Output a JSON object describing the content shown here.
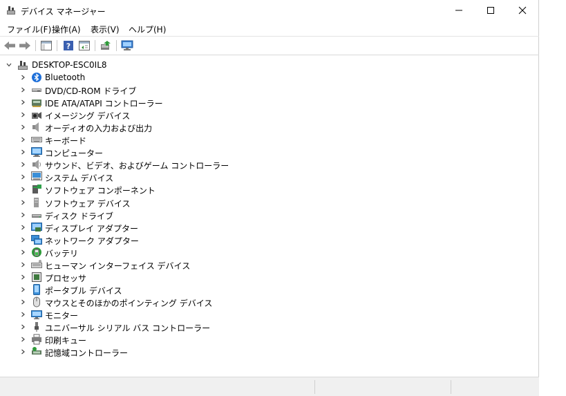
{
  "window": {
    "title": "デバイス マネージャー"
  },
  "menu": [
    {
      "label": "ファイル(F)"
    },
    {
      "label": "操作(A)"
    },
    {
      "label": "表示(V)"
    },
    {
      "label": "ヘルプ(H)"
    }
  ],
  "tree": {
    "root": {
      "label": "DESKTOP-ESC0IL8"
    },
    "items": [
      {
        "label": "Bluetooth",
        "icon": "bluetooth-icon"
      },
      {
        "label": "DVD/CD-ROM ドライブ",
        "icon": "dvd-drive-icon"
      },
      {
        "label": "IDE ATA/ATAPI コントローラー",
        "icon": "ide-controller-icon"
      },
      {
        "label": "イメージング デバイス",
        "icon": "imaging-device-icon"
      },
      {
        "label": "オーディオの入力および出力",
        "icon": "speaker-icon"
      },
      {
        "label": "キーボード",
        "icon": "keyboard-icon"
      },
      {
        "label": "コンピューター",
        "icon": "computer-icon"
      },
      {
        "label": "サウンド、ビデオ、およびゲーム コントローラー",
        "icon": "sound-icon"
      },
      {
        "label": "システム デバイス",
        "icon": "system-device-icon"
      },
      {
        "label": "ソフトウェア コンポーネント",
        "icon": "software-component-icon"
      },
      {
        "label": "ソフトウェア デバイス",
        "icon": "software-device-icon"
      },
      {
        "label": "ディスク ドライブ",
        "icon": "disk-drive-icon"
      },
      {
        "label": "ディスプレイ アダプター",
        "icon": "display-adapter-icon"
      },
      {
        "label": "ネットワーク アダプター",
        "icon": "network-adapter-icon"
      },
      {
        "label": "バッテリ",
        "icon": "battery-icon"
      },
      {
        "label": "ヒューマン インターフェイス デバイス",
        "icon": "hid-icon"
      },
      {
        "label": "プロセッサ",
        "icon": "processor-icon"
      },
      {
        "label": "ポータブル デバイス",
        "icon": "portable-device-icon"
      },
      {
        "label": "マウスとそのほかのポインティング デバイス",
        "icon": "mouse-icon"
      },
      {
        "label": "モニター",
        "icon": "monitor-icon"
      },
      {
        "label": "ユニバーサル シリアル バス コントローラー",
        "icon": "usb-icon"
      },
      {
        "label": "印刷キュー",
        "icon": "printer-icon"
      },
      {
        "label": "記憶域コントローラー",
        "icon": "storage-controller-icon"
      }
    ]
  }
}
